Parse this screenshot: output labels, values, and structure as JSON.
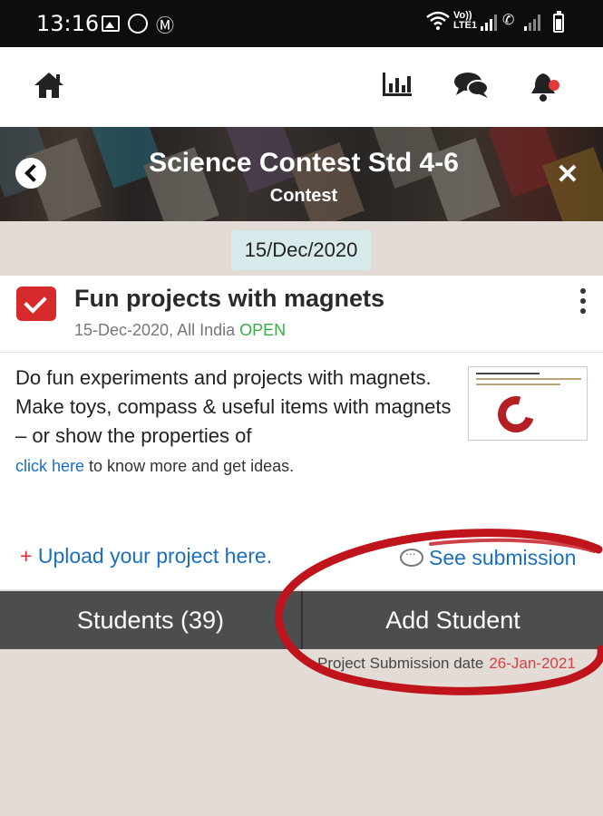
{
  "status_bar": {
    "time": "13:16",
    "volte": "Vo))\nLTE1",
    "icons": [
      "gallery-icon",
      "whatsapp-icon",
      "gmail-icon",
      "wifi-icon",
      "signal-icon",
      "call-icon",
      "battery-icon"
    ]
  },
  "nav": {
    "icons": [
      "home-icon",
      "stats-icon",
      "chat-icon",
      "bell-icon"
    ],
    "notification_color": "#e53935"
  },
  "banner": {
    "title": "Science Contest Std 4-6",
    "subtitle": "Contest"
  },
  "date_chip": "15/Dec/2020",
  "project": {
    "title": "Fun projects with magnets",
    "meta": "15-Dec-2020, All India ",
    "status": "OPEN",
    "description": "Do fun experiments and projects with magnets. Make toys, compass & useful items with magnets – or show the properties of",
    "link_text": "click here",
    "link_suffix": " to know more and get ideas."
  },
  "actions": {
    "upload_plus": "+ ",
    "upload_label": "Upload your project here.",
    "see_submission_label": "See submission"
  },
  "tabs": {
    "students_label": "Students (39)",
    "add_student_label": "Add Student"
  },
  "submission": {
    "label": "Project Submission date",
    "date": "26-Jan-2021"
  },
  "colors": {
    "accent_blue": "#1a6fc1",
    "check_red": "#d72b2b",
    "open_green": "#3caa4b",
    "tab_bar": "#4b4d4f",
    "annotation_red": "#c0141c"
  }
}
